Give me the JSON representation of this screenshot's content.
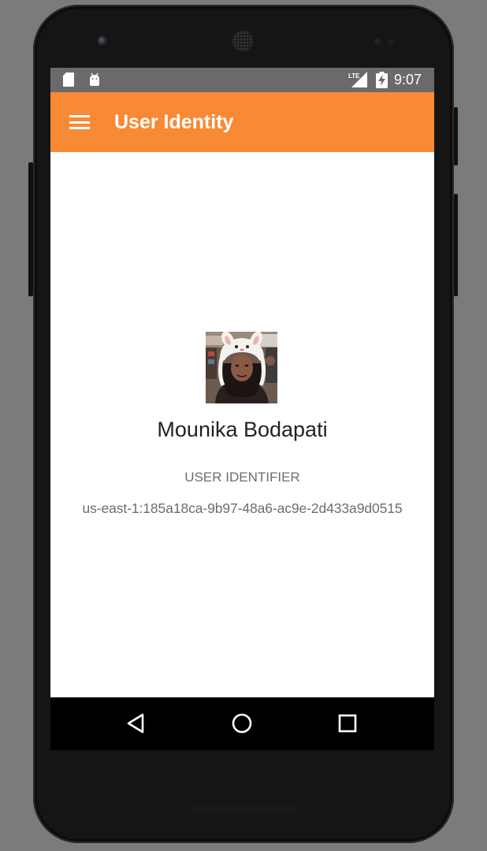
{
  "status_bar": {
    "time": "9:07",
    "network": "LTE",
    "icons": [
      "sd-card-icon",
      "android-debug-icon",
      "lte-signal-icon",
      "battery-charging-icon"
    ]
  },
  "app_bar": {
    "title": "User Identity",
    "menu_icon": "hamburger-menu-icon",
    "color": "#f88a35"
  },
  "profile": {
    "name": "Mounika Bodapati",
    "identifier_label": "USER IDENTIFIER",
    "identifier_value": "us-east-1:185a18ca-9b97-48a6-ac9e-2d433a9d0515"
  },
  "nav_bar": {
    "buttons": [
      "back-icon",
      "home-icon",
      "recents-icon"
    ]
  }
}
